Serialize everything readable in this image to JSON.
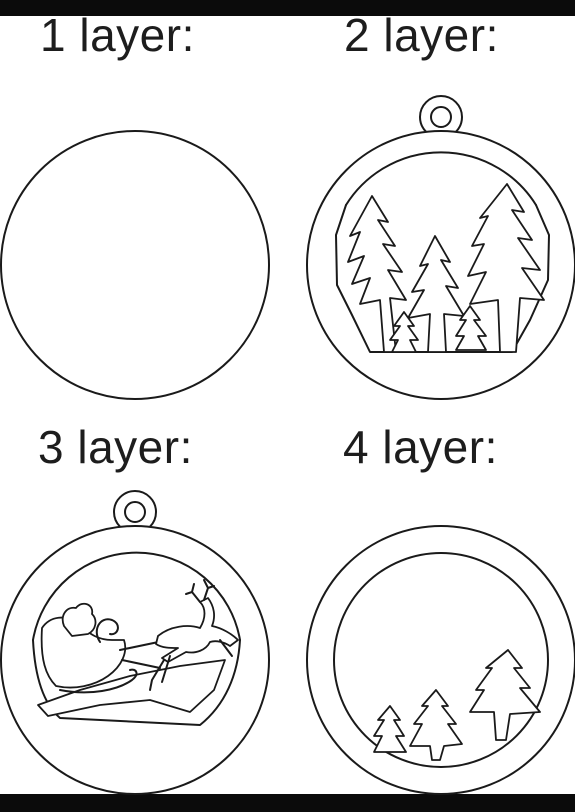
{
  "labels": {
    "layer1": "1 layer:",
    "layer2": "2 layer:",
    "layer3": "3 layer:",
    "layer4": "4 layer:"
  },
  "colors": {
    "line": "#1a1a1a",
    "background": "#ffffff",
    "frame_bar": "#0b0b0b"
  },
  "ornaments": [
    {
      "layer": 1,
      "shape": "plain disc",
      "hanger_loop": false
    },
    {
      "layer": 2,
      "shape": "ring frame with pine forest cut-out",
      "hanger_loop": true
    },
    {
      "layer": 3,
      "shape": "ring frame with Santa sleigh and reindeer",
      "hanger_loop": true
    },
    {
      "layer": 4,
      "shape": "ring frame with trees in lower arc",
      "hanger_loop": false
    }
  ]
}
